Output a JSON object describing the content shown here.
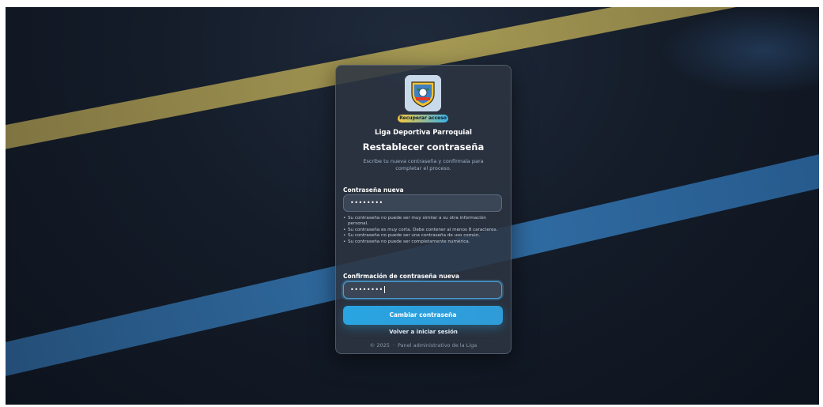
{
  "card": {
    "badge": "Recuperar acceso",
    "organization": "Liga Deportiva Parroquial",
    "title": "Restablecer contraseña",
    "subtitle": "Escribe tu nueva contraseña y confírmala para completar el proceso."
  },
  "form": {
    "new_password": {
      "label": "Contraseña nueva",
      "value": "••••••••"
    },
    "help_text": [
      "Su contraseña no puede ser muy similar a su otra información personal.",
      "Su contraseña es muy corta. Debe contener al menos 8 caracteres.",
      "Su contraseña no puede ser una contraseña de uso común.",
      "Su contraseña no puede ser completamente numérica."
    ],
    "confirm_password": {
      "label": "Confirmación de contraseña nueva",
      "value": "••••••••"
    },
    "submit_label": "Cambiar contraseña",
    "back_link": "Volver a iniciar sesión"
  },
  "footer": {
    "copyright": "© 2025",
    "separator": "·",
    "text": "Panel administrativo de la Liga"
  },
  "colors": {
    "accent": "#29a5e2",
    "background": "#141c29",
    "card": "#2c3442",
    "stripe_gold": "#d2be5c",
    "stripe_blue": "#3478b4"
  },
  "icons": {
    "logo": "league-shield-logo"
  }
}
